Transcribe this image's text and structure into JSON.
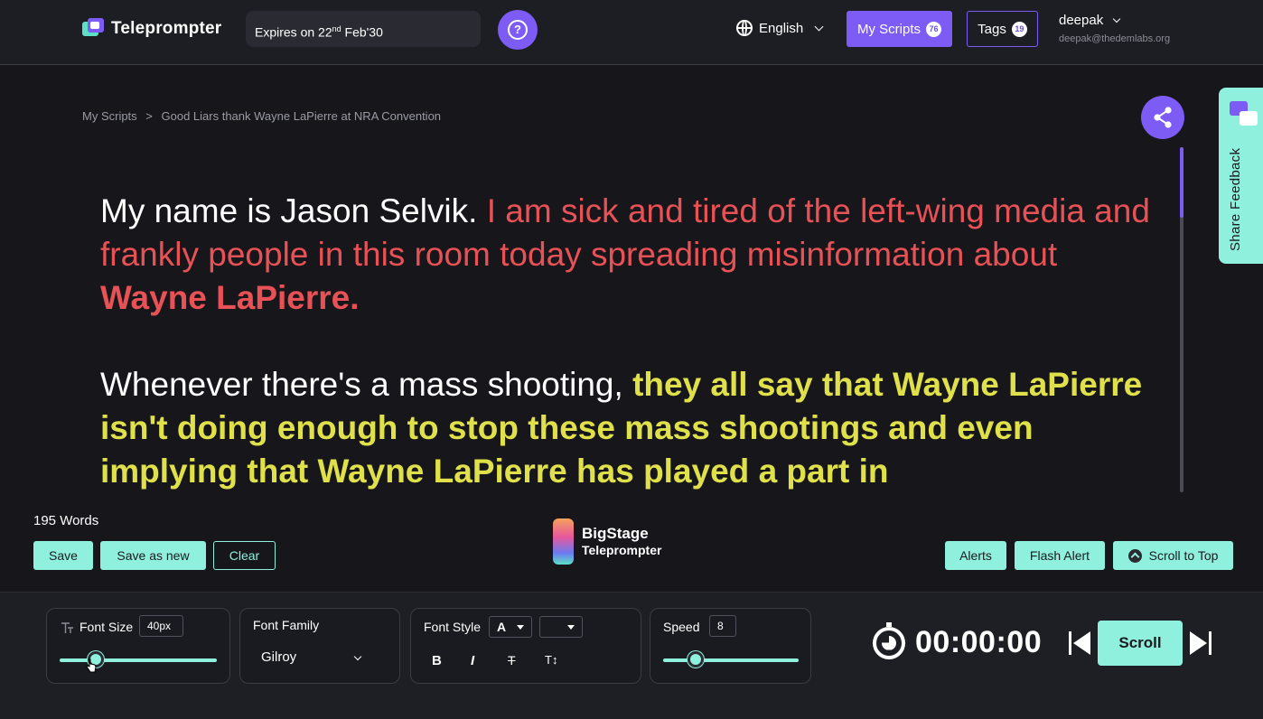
{
  "header": {
    "app_name": "Teleprompter",
    "expires_prefix": "Expires on 22",
    "expires_sup": "nd",
    "expires_suffix": " Feb'30",
    "help_label": "?",
    "language": "English",
    "my_scripts_label": "My Scripts",
    "my_scripts_count": "76",
    "tags_label": "Tags",
    "tags_count": "19",
    "user_name": "deepak",
    "user_email": "deepak@thedemlabs.org"
  },
  "breadcrumb": {
    "root": "My Scripts",
    "separator": ">",
    "current": "Good Liars thank Wayne LaPierre at NRA Convention"
  },
  "feedback": {
    "label": "Share Feedback"
  },
  "script": {
    "p1_white": "My name is Jason Selvik. ",
    "p1_red": "I am sick and tired of the left-wing media and frankly people in this room today spreading misinformation about ",
    "p1_red_bold": "Wayne LaPierre.",
    "p2_white": "Whenever there's a mass shooting, ",
    "p2_yellow_bold": "they all say that Wayne LaPierre isn't doing enough to stop these mass shootings and even implying that Wayne LaPierre has played a part in"
  },
  "word_count": "195 Words",
  "toolbar": {
    "save": "Save",
    "save_as_new": "Save as new",
    "clear": "Clear",
    "alerts": "Alerts",
    "flash_alert": "Flash Alert",
    "scroll_to_top": "Scroll to Top"
  },
  "brand": {
    "line1": "BigStage",
    "line2": "Teleprompter"
  },
  "controls": {
    "font_size_label": "Font Size",
    "font_size_value": "40px",
    "font_size_slider": 0.23,
    "font_family_label": "Font Family",
    "font_family_value": "Gilroy",
    "font_style_label": "Font Style",
    "font_style_a": "A",
    "style_bold": "B",
    "style_italic": "I",
    "style_strike": "T",
    "style_size": "T↕",
    "speed_label": "Speed",
    "speed_value": "8",
    "speed_slider": 0.24,
    "timer": "00:00:00",
    "scroll_label": "Scroll"
  },
  "colors": {
    "accent_purple": "#7c5cf5",
    "accent_mint": "#8ff0dd",
    "text_red": "#e85256",
    "text_yellow": "#e0e14a"
  }
}
